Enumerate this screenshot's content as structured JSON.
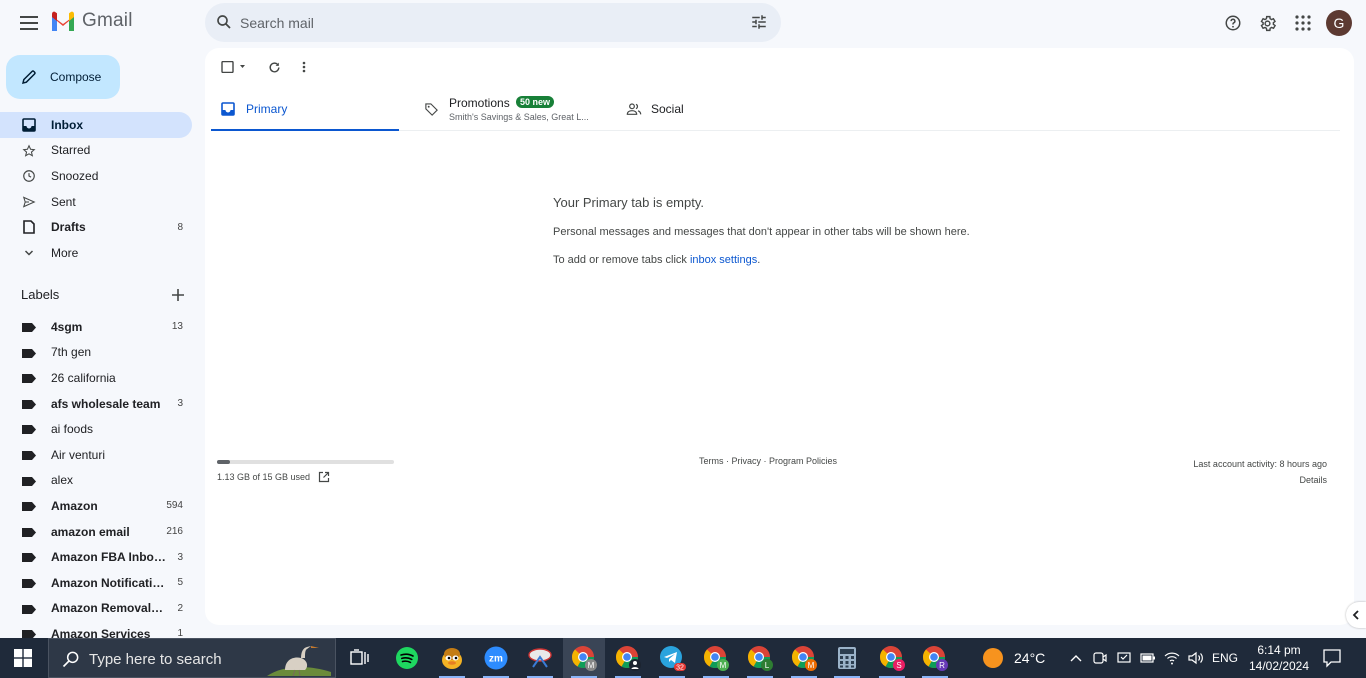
{
  "app": {
    "name": "Gmail",
    "search_placeholder": "Search mail",
    "avatar_letter": "G",
    "compose_label": "Compose"
  },
  "nav": [
    {
      "label": "Inbox",
      "icon": "inbox-icon",
      "count": "",
      "active": true,
      "bold": true
    },
    {
      "label": "Starred",
      "icon": "star-icon",
      "count": "",
      "active": false,
      "bold": false
    },
    {
      "label": "Snoozed",
      "icon": "clock-icon",
      "count": "",
      "active": false,
      "bold": false
    },
    {
      "label": "Sent",
      "icon": "send-icon",
      "count": "",
      "active": false,
      "bold": false
    },
    {
      "label": "Drafts",
      "icon": "draft-icon",
      "count": "8",
      "active": false,
      "bold": true
    },
    {
      "label": "More",
      "icon": "chevron-down-icon",
      "count": "",
      "active": false,
      "bold": false
    }
  ],
  "labels_heading": "Labels",
  "labels": [
    {
      "name": "4sgm",
      "count": "13",
      "bold": true
    },
    {
      "name": "7th gen",
      "count": "",
      "bold": false
    },
    {
      "name": "26 california",
      "count": "",
      "bold": false
    },
    {
      "name": "afs wholesale team",
      "count": "3",
      "bold": true
    },
    {
      "name": "ai foods",
      "count": "",
      "bold": false
    },
    {
      "name": "Air venturi",
      "count": "",
      "bold": false
    },
    {
      "name": "alex",
      "count": "",
      "bold": false
    },
    {
      "name": "Amazon",
      "count": "594",
      "bold": true
    },
    {
      "name": "amazon email",
      "count": "216",
      "bold": true
    },
    {
      "name": "Amazon FBA Inbou...",
      "count": "3",
      "bold": true
    },
    {
      "name": "Amazon Notificatio...",
      "count": "5",
      "bold": true
    },
    {
      "name": "Amazon Removal N...",
      "count": "2",
      "bold": true
    },
    {
      "name": "Amazon Services",
      "count": "1",
      "bold": true
    }
  ],
  "tabs": {
    "primary": "Primary",
    "promotions": "Promotions",
    "promotions_badge": "50 new",
    "promotions_sub": "Smith's Savings & Sales, Great L...",
    "social": "Social"
  },
  "empty": {
    "heading": "Your Primary tab is empty.",
    "line1": "Personal messages and messages that don't appear in other tabs will be shown here.",
    "line2_prefix": "To add or remove tabs click ",
    "line2_link": "inbox settings",
    "line2_suffix": "."
  },
  "storage": {
    "used_text": "1.13 GB of 15 GB used",
    "fraction": 0.075
  },
  "footer": {
    "terms": "Terms",
    "privacy": "Privacy",
    "policies": "Program Policies",
    "sep": " · ",
    "activity": "Last account activity: 8 hours ago",
    "details": "Details"
  },
  "taskbar": {
    "search_placeholder": "Type here to search",
    "temperature": "24°C",
    "lang": "ENG",
    "time": "6:14 pm",
    "date": "14/02/2024",
    "telegram_badge": "32"
  },
  "colors": {
    "accent": "#0b57d0",
    "compose_bg": "#c2e7ff",
    "active_nav_bg": "#d3e3fd",
    "badge_green": "#188038",
    "taskbar_bg": "#1f2a3a"
  }
}
